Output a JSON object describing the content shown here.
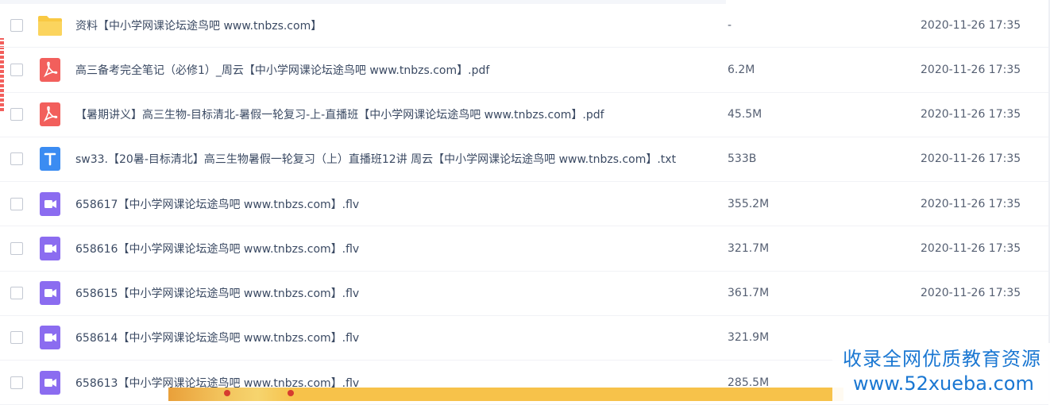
{
  "files": [
    {
      "name": "资料【中小学网课论坛途鸟吧 www.tnbzs.com】",
      "size": "-",
      "date": "2020-11-26 17:35",
      "icon": "folder-icon",
      "type": "folder"
    },
    {
      "name": "高三备考完全笔记（必修1）_周云【中小学网课论坛途鸟吧 www.tnbzs.com】.pdf",
      "size": "6.2M",
      "date": "2020-11-26 17:35",
      "icon": "pdf-icon",
      "type": "pdf"
    },
    {
      "name": "【暑期讲义】高三生物-目标清北-暑假一轮复习-上-直播班【中小学网课论坛途鸟吧 www.tnbzs.com】.pdf",
      "size": "45.5M",
      "date": "2020-11-26 17:35",
      "icon": "pdf-icon",
      "type": "pdf"
    },
    {
      "name": "sw33.【20暑-目标清北】高三生物暑假一轮复习（上）直播班12讲 周云【中小学网课论坛途鸟吧 www.tnbzs.com】.txt",
      "size": "533B",
      "date": "2020-11-26 17:35",
      "icon": "text-file-icon",
      "type": "txt"
    },
    {
      "name": "658617【中小学网课论坛途鸟吧 www.tnbzs.com】.flv",
      "size": "355.2M",
      "date": "2020-11-26 17:35",
      "icon": "video-icon",
      "type": "video"
    },
    {
      "name": "658616【中小学网课论坛途鸟吧 www.tnbzs.com】.flv",
      "size": "321.7M",
      "date": "2020-11-26 17:35",
      "icon": "video-icon",
      "type": "video"
    },
    {
      "name": "658615【中小学网课论坛途鸟吧 www.tnbzs.com】.flv",
      "size": "361.7M",
      "date": "2020-11-26 17:35",
      "icon": "video-icon",
      "type": "video"
    },
    {
      "name": "658614【中小学网课论坛途鸟吧 www.tnbzs.com】.flv",
      "size": "321.9M",
      "date": "",
      "icon": "video-icon",
      "type": "video"
    },
    {
      "name": "658613【中小学网课论坛途鸟吧 www.tnbzs.com】.flv",
      "size": "285.5M",
      "date": "",
      "icon": "video-icon",
      "type": "video"
    }
  ],
  "watermark": {
    "line1": "收录全网优质教育资源",
    "line2": "www.52xueba.com"
  },
  "colors": {
    "folder": "#f9c943",
    "pdf": "#f25f5c",
    "txt": "#3b8cf2",
    "video": "#8b6cf0",
    "watermark": "#1a77d2"
  }
}
